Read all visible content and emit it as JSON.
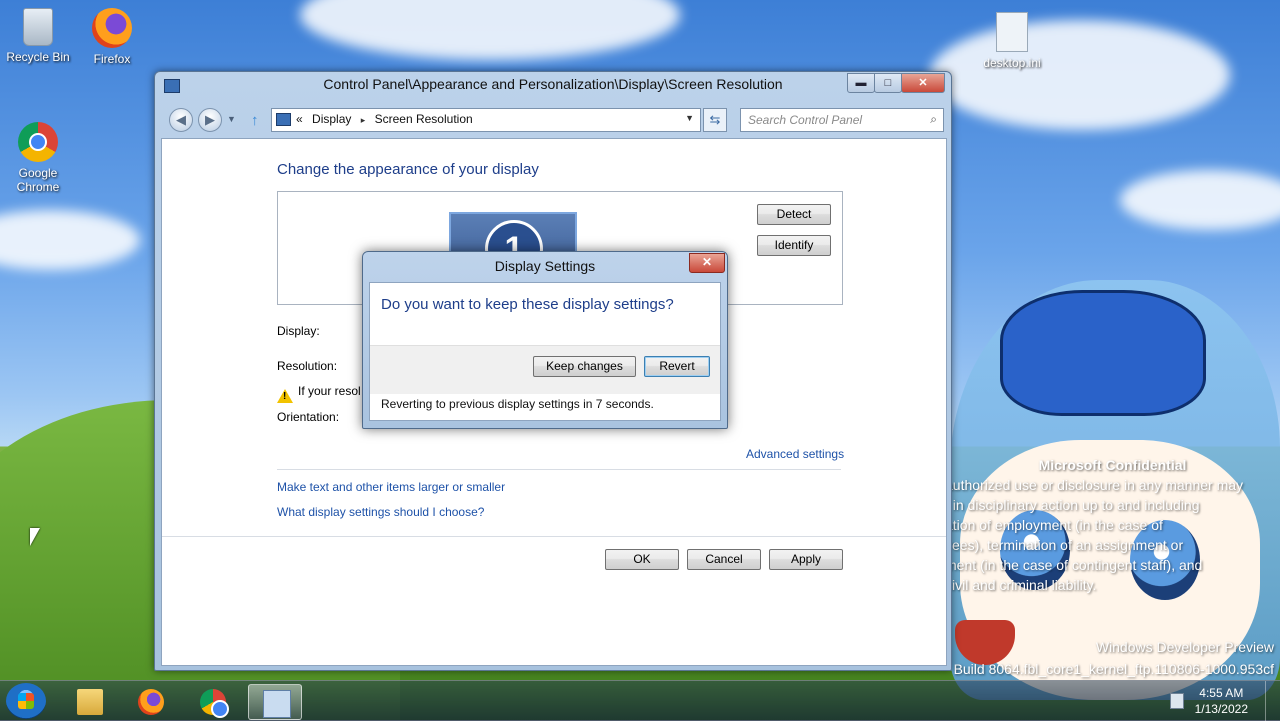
{
  "desktop": {
    "icons": [
      {
        "label": "Recycle Bin"
      },
      {
        "label": "Firefox"
      },
      {
        "label": "Google Chrome"
      },
      {
        "label": "desktop.ini"
      }
    ],
    "watermark": {
      "title": "Microsoft Confidential",
      "lines": [
        "authorized use or disclosure in any manner may",
        "t in disciplinary action up to and including",
        "ation of employment (in the case of",
        "yees), termination of an assignment or",
        "ment (in the case of contingent staff), and",
        "civil and criminal liability."
      ],
      "footer_1": "Windows Developer Preview",
      "footer_2": "Build 8064.fbl_core1_kernel_ftp.110806-1000.953cf"
    }
  },
  "window": {
    "title": "Control Panel\\Appearance and Personalization\\Display\\Screen Resolution",
    "controls": {
      "min": "▬",
      "max": "□",
      "close": "✕"
    },
    "address": {
      "prefix": "«",
      "crumbs": [
        "Display",
        "Screen Resolution"
      ],
      "separator": "▸"
    },
    "search_placeholder": "Search Control Panel",
    "heading": "Change the appearance of your display",
    "monitor_number": "1",
    "detect_label": "Detect",
    "identify_label": "Identify",
    "display_label": "Display:",
    "resolution_label": "Resolution:",
    "warning_text": "If your resol",
    "orientation_label": "Orientation:",
    "advanced_link": "Advanced settings",
    "link_text_size": "Make text and other items larger or smaller",
    "link_help": "What display settings should I choose?",
    "ok_label": "OK",
    "cancel_label": "Cancel",
    "apply_label": "Apply"
  },
  "dialog": {
    "title": "Display Settings",
    "question": "Do you want to keep these display settings?",
    "keep_label": "Keep changes",
    "revert_label": "Revert",
    "status": "Reverting to previous display settings in 7 seconds."
  },
  "taskbar": {
    "time": "4:55 AM",
    "date": "1/13/2022"
  }
}
